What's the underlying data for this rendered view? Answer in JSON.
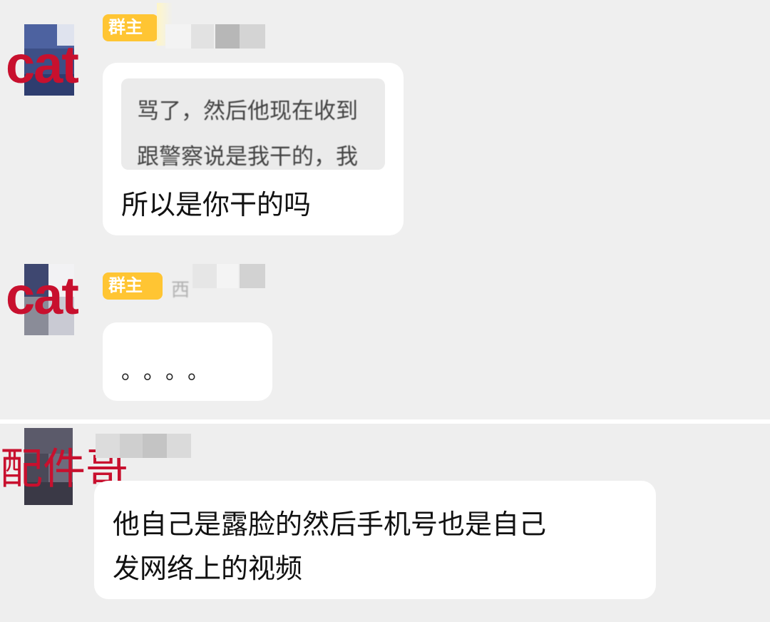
{
  "chat_top": {
    "messages": [
      {
        "overlay_label": "cat",
        "role_badge": "群主",
        "quote_lines": [
          "骂了，然后他现在收到",
          "跟警察说是我干的，我"
        ],
        "text": "所以是你干的吗"
      },
      {
        "overlay_label": "cat",
        "role_badge": "群主",
        "sender_fragment": "西",
        "text": "。。。。"
      }
    ]
  },
  "chat_bottom": {
    "messages": [
      {
        "overlay_label": "配件哥",
        "lines": [
          "他自己是露脸的然后手机号也是自己",
          "发网络上的视频"
        ]
      }
    ]
  },
  "colors": {
    "background": "#efefef",
    "bubble": "#ffffff",
    "badge": "#ffc533",
    "overlay_label": "#c8102e",
    "quote_box": "#ebebeb"
  },
  "icons": [
    "avatar-blurred",
    "avatar-blurred",
    "avatar-blurred"
  ]
}
